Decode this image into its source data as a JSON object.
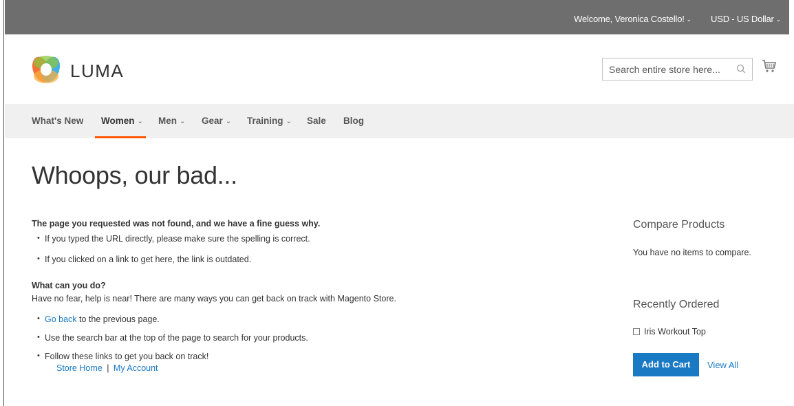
{
  "topbar": {
    "welcome": "Welcome, Veronica Costello!",
    "currency": "USD - US Dollar"
  },
  "header": {
    "logo_text": "LUMA",
    "search_placeholder": "Search entire store here..."
  },
  "nav": {
    "items": [
      {
        "label": "What's New",
        "dropdown": false
      },
      {
        "label": "Women",
        "dropdown": true,
        "active": true
      },
      {
        "label": "Men",
        "dropdown": true
      },
      {
        "label": "Gear",
        "dropdown": true
      },
      {
        "label": "Training",
        "dropdown": true
      },
      {
        "label": "Sale",
        "dropdown": false
      },
      {
        "label": "Blog",
        "dropdown": false
      }
    ]
  },
  "page": {
    "title": "Whoops, our bad..."
  },
  "content": {
    "heading1": "The page you requested was not found, and we have a fine guess why.",
    "reasons": [
      "If you typed the URL directly, please make sure the spelling is correct.",
      "If you clicked on a link to get here, the link is outdated."
    ],
    "heading2": "What can you do?",
    "intro": "Have no fear, help is near! There are many ways you can get back on track with Magento Store.",
    "go_back_link": "Go back",
    "go_back_rest": " to the previous page.",
    "search_tip": "Use the search bar at the top of the page to search for your products.",
    "links_tip": "Follow these links to get you back on track!",
    "store_home": "Store Home",
    "separator": "|",
    "my_account": "My Account"
  },
  "sidebar": {
    "compare_title": "Compare Products",
    "compare_empty": "You have no items to compare.",
    "recent_title": "Recently Ordered",
    "recent_item": "Iris Workout Top",
    "add_to_cart": "Add to Cart",
    "view_all": "View All"
  },
  "colors": {
    "accent_link": "#1979c3",
    "nav_active_underline": "#ff5501",
    "topbar_bg": "#6e6e6e"
  }
}
